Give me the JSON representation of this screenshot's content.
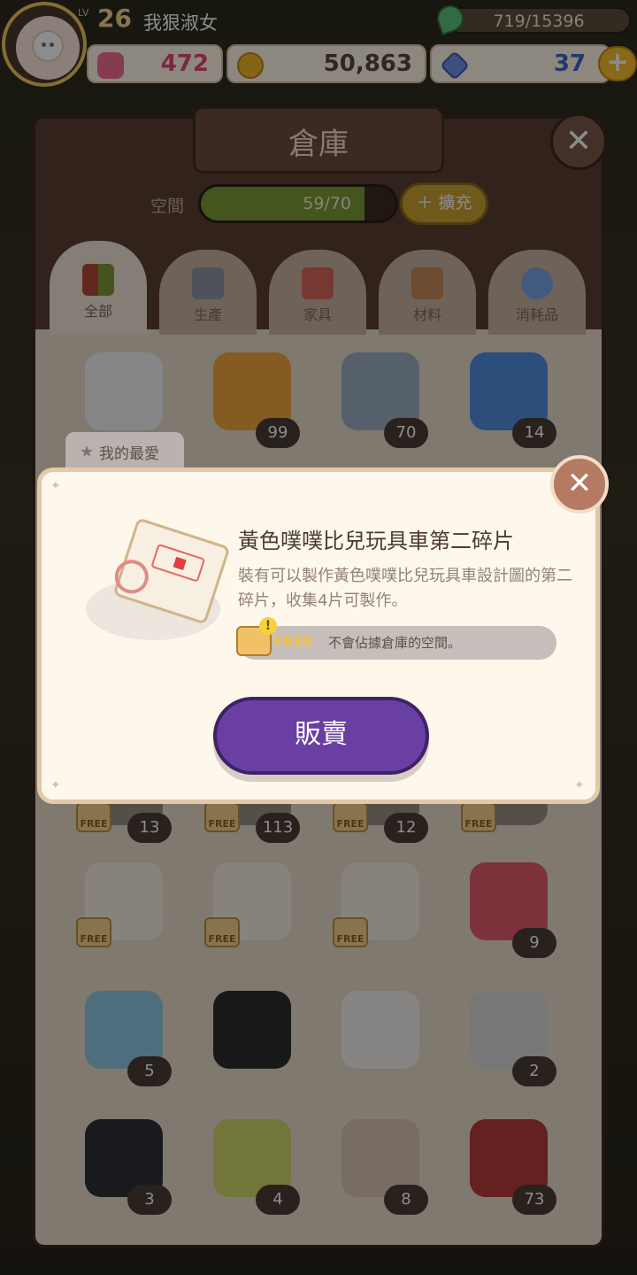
{
  "player": {
    "level_tag": "LV",
    "level": "26",
    "name": "我狠淑女"
  },
  "stamina": {
    "text": "719/15396"
  },
  "resources": {
    "hearts": "472",
    "coins": "50,863",
    "gems": "37"
  },
  "warehouse": {
    "title": "倉庫",
    "space_label": "空間",
    "space_text": "59/70",
    "space_progress": 0.843,
    "expand_label": "擴充",
    "tabs": [
      {
        "label": "全部",
        "icon": "grid-icon"
      },
      {
        "label": "生產",
        "icon": "hammer-icon"
      },
      {
        "label": "家具",
        "icon": "sofa-icon"
      },
      {
        "label": "材料",
        "icon": "wood-icon"
      },
      {
        "label": "消耗品",
        "icon": "potion-icon"
      }
    ],
    "favorites_label": "我的最愛",
    "items": [
      {
        "name": "cotton",
        "count": "",
        "color": "#f4f4f8",
        "free": false
      },
      {
        "name": "honey-jar",
        "count": "99",
        "color": "#f0a83c",
        "free": false
      },
      {
        "name": "fish",
        "count": "70",
        "color": "#9bb0c4",
        "free": false
      },
      {
        "name": "blue-bottle",
        "count": "14",
        "color": "#4f8fe0",
        "free": false
      },
      {
        "name": "free-item-a",
        "count": "13",
        "color": "#9a9186",
        "free": true
      },
      {
        "name": "free-item-b",
        "count": "113",
        "color": "#9a9186",
        "free": true
      },
      {
        "name": "free-item-c",
        "count": "12",
        "color": "#9a9186",
        "free": true
      },
      {
        "name": "free-item-d",
        "count": "",
        "color": "#9a9186",
        "free": true
      },
      {
        "name": "coupon-1",
        "count": "",
        "color": "#f6efe2",
        "free": true
      },
      {
        "name": "coupon-2",
        "count": "",
        "color": "#f6efe2",
        "free": true
      },
      {
        "name": "coupon-3",
        "count": "",
        "color": "#f6efe2",
        "free": true
      },
      {
        "name": "pompoms",
        "count": "9",
        "color": "#e45a6a",
        "free": false
      },
      {
        "name": "glass-pane",
        "count": "5",
        "color": "#8fc9e6",
        "free": false
      },
      {
        "name": "black-roll",
        "count": "",
        "color": "#2c2c2e",
        "free": false
      },
      {
        "name": "plate",
        "count": "",
        "color": "#f6f3ef",
        "free": false
      },
      {
        "name": "cutlery",
        "count": "2",
        "color": "#d9d9d9",
        "free": false
      },
      {
        "name": "dark-panel",
        "count": "3",
        "color": "#2f3038",
        "free": false
      },
      {
        "name": "oil-bottle",
        "count": "4",
        "color": "#cfd76a",
        "free": false
      },
      {
        "name": "fur",
        "count": "8",
        "color": "#d9c7b2",
        "free": false
      },
      {
        "name": "meat",
        "count": "73",
        "color": "#b83b3b",
        "free": false
      }
    ],
    "free_badge": "FREE"
  },
  "popup": {
    "title": "黃色噗噗比兒玩具車第二碎片",
    "description": "裝有可以製作黃色噗噗比兒玩具車設計圖的第二碎片，收集4片可製作。",
    "free_label": "FREE",
    "free_text": "不會佔據倉庫的空間。",
    "sell_label": "販賣"
  },
  "colors": {
    "accent_purple": "#6a3fa3",
    "panel_brown": "#5b3f33",
    "bar_green": "#7d9c36"
  }
}
